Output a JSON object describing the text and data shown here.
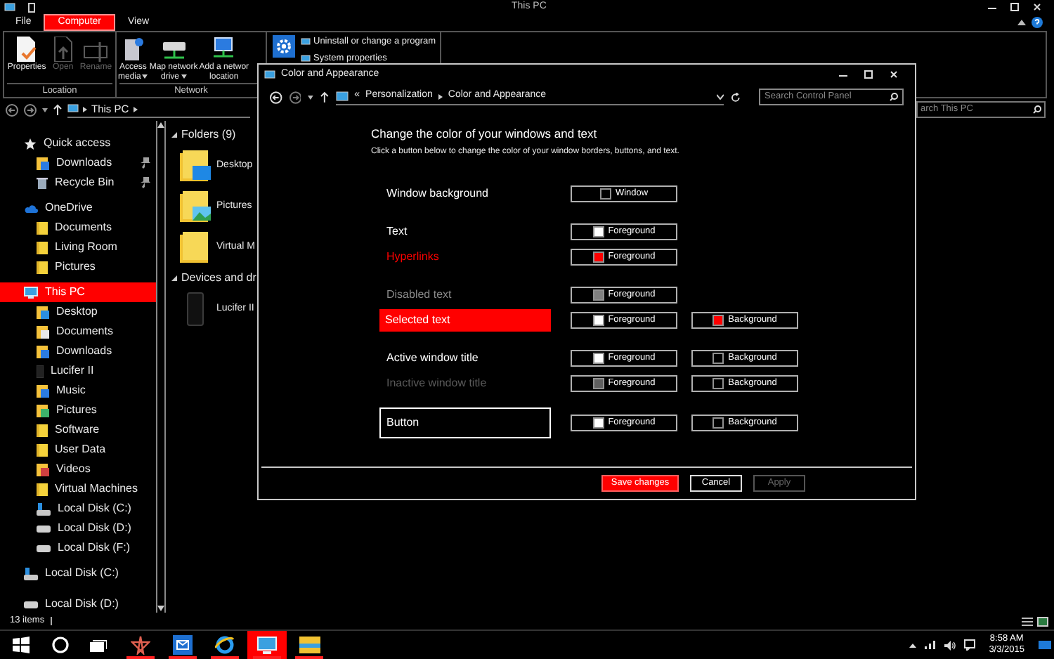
{
  "explorer": {
    "title": "This PC",
    "ribbon_tabs": [
      {
        "label": "File",
        "selected": false
      },
      {
        "label": "Computer",
        "selected": true
      },
      {
        "label": "View",
        "selected": false
      }
    ],
    "ribbon_groups": [
      {
        "label": "Location",
        "tools": [
          {
            "lines": [
              "Properties"
            ],
            "kind": "properties",
            "disabled": false,
            "dropdown": false
          },
          {
            "lines": [
              "Open"
            ],
            "kind": "open",
            "disabled": true,
            "dropdown": false
          },
          {
            "lines": [
              "Rename"
            ],
            "kind": "rename",
            "disabled": true,
            "dropdown": false
          }
        ]
      },
      {
        "label": "Network",
        "tools": [
          {
            "lines": [
              "Access",
              "media"
            ],
            "kind": "media",
            "disabled": false,
            "dropdown": true
          },
          {
            "lines": [
              "Map network",
              "drive"
            ],
            "kind": "map-drive",
            "disabled": false,
            "dropdown": true
          },
          {
            "lines": [
              "Add a networ",
              "location"
            ],
            "kind": "network-location",
            "disabled": false,
            "dropdown": false
          }
        ]
      }
    ],
    "system_links": [
      "Uninstall or change a program",
      "System properties"
    ],
    "path": [
      "This PC"
    ],
    "search": {
      "placeholder": "arch This PC"
    },
    "nav": [
      {
        "label": "Quick access",
        "kind": "star",
        "selected": false,
        "pinned": false,
        "children": [
          {
            "label": "Downloads",
            "kind": "downloads",
            "selected": false,
            "pinned": true
          },
          {
            "label": "Recycle Bin",
            "kind": "bin",
            "selected": false,
            "pinned": true
          }
        ]
      },
      {
        "label": "OneDrive",
        "kind": "cloud",
        "selected": false,
        "pinned": false,
        "children": [
          {
            "label": "Documents",
            "kind": "folder",
            "selected": false,
            "pinned": false
          },
          {
            "label": "Living Room",
            "kind": "folder",
            "selected": false,
            "pinned": false
          },
          {
            "label": "Pictures",
            "kind": "folder",
            "selected": false,
            "pinned": false
          }
        ]
      },
      {
        "label": "This PC",
        "kind": "pc",
        "selected": true,
        "pinned": false,
        "children": [
          {
            "label": "Desktop",
            "kind": "desktop",
            "selected": false,
            "pinned": false
          },
          {
            "label": "Documents",
            "kind": "documents",
            "selected": false,
            "pinned": false
          },
          {
            "label": "Downloads",
            "kind": "downloads",
            "selected": false,
            "pinned": false
          },
          {
            "label": "Lucifer II",
            "kind": "phone",
            "selected": false,
            "pinned": false
          },
          {
            "label": "Music",
            "kind": "music",
            "selected": false,
            "pinned": false
          },
          {
            "label": "Pictures",
            "kind": "pictures",
            "selected": false,
            "pinned": false
          },
          {
            "label": "Software",
            "kind": "folder",
            "selected": false,
            "pinned": false
          },
          {
            "label": "User Data",
            "kind": "folder",
            "selected": false,
            "pinned": false
          },
          {
            "label": "Videos",
            "kind": "videos",
            "selected": false,
            "pinned": false
          },
          {
            "label": "Virtual Machines",
            "kind": "folder",
            "selected": false,
            "pinned": false
          },
          {
            "label": "Local Disk (C:)",
            "kind": "sysdrive",
            "selected": false,
            "pinned": false
          },
          {
            "label": "Local Disk (D:)",
            "kind": "drive",
            "selected": false,
            "pinned": false
          },
          {
            "label": "Local Disk (F:)",
            "kind": "drive",
            "selected": false,
            "pinned": false
          }
        ]
      },
      {
        "label": "Local Disk (C:)",
        "kind": "sysdrive",
        "selected": false,
        "pinned": false
      },
      {
        "label": "Local Disk (D:)",
        "kind": "drive",
        "selected": false,
        "pinned": false
      }
    ],
    "sections": [
      {
        "title": "Folders (9)",
        "items": [
          {
            "label": "Desktop",
            "kind": "desktop"
          },
          {
            "label": "Pictures",
            "kind": "pictures"
          },
          {
            "label": "Virtual M",
            "kind": "folder"
          }
        ]
      },
      {
        "title": "Devices and dr",
        "items": [
          {
            "label": "Lucifer II",
            "kind": "phone"
          }
        ]
      }
    ],
    "status": "13 items"
  },
  "dialog": {
    "title": "Color and Appearance",
    "breadcrumb": [
      "«",
      "Personalization",
      "Color and Appearance"
    ],
    "search": {
      "placeholder": "Search Control Panel"
    },
    "heading": "Change the color of your windows and text",
    "subtext": "Click a button below to change the color of your window borders, buttons, and text.",
    "groups": [
      [
        {
          "label": "Window background",
          "kind": "plain",
          "swatches": [
            {
              "label": "Window",
              "color": "#000000"
            }
          ]
        }
      ],
      [
        {
          "label": "Text",
          "kind": "plain",
          "swatches": [
            {
              "label": "Foreground",
              "color": "#ffffff"
            }
          ]
        },
        {
          "label": "Hyperlinks",
          "kind": "link",
          "swatches": [
            {
              "label": "Foreground",
              "color": "#ff0000"
            }
          ]
        }
      ],
      [
        {
          "label": "Disabled text",
          "kind": "disabled",
          "swatches": [
            {
              "label": "Foreground",
              "color": "#808080"
            }
          ]
        },
        {
          "label": "Selected text",
          "kind": "selected",
          "swatches": [
            {
              "label": "Foreground",
              "color": "#ffffff"
            },
            {
              "label": "Background",
              "color": "#ff0000"
            }
          ]
        }
      ],
      [
        {
          "label": "Active window title",
          "kind": "plain",
          "swatches": [
            {
              "label": "Foreground",
              "color": "#ffffff"
            },
            {
              "label": "Background",
              "color": "#000000"
            }
          ]
        },
        {
          "label": "Inactive window title",
          "kind": "inactive",
          "swatches": [
            {
              "label": "Foreground",
              "color": "#606060"
            },
            {
              "label": "Background",
              "color": "#000000"
            }
          ]
        }
      ],
      [
        {
          "label": "Button",
          "kind": "button",
          "swatches": [
            {
              "label": "Foreground",
              "color": "#ffffff"
            },
            {
              "label": "Background",
              "color": "#000000"
            }
          ]
        }
      ]
    ],
    "buttons": [
      {
        "label": "Save changes",
        "kind": "primary",
        "disabled": false
      },
      {
        "label": "Cancel",
        "kind": "normal",
        "disabled": false
      },
      {
        "label": "Apply",
        "kind": "normal",
        "disabled": true
      }
    ]
  },
  "taskbar": {
    "apps": [
      {
        "kind": "hub",
        "running": true,
        "active": false
      },
      {
        "kind": "mail",
        "running": true,
        "active": false
      },
      {
        "kind": "browser",
        "running": true,
        "active": false
      },
      {
        "kind": "control-panel",
        "running": true,
        "active": true
      },
      {
        "kind": "explorer",
        "running": true,
        "active": false
      }
    ],
    "time": "8:58 AM",
    "date": "3/3/2015"
  }
}
